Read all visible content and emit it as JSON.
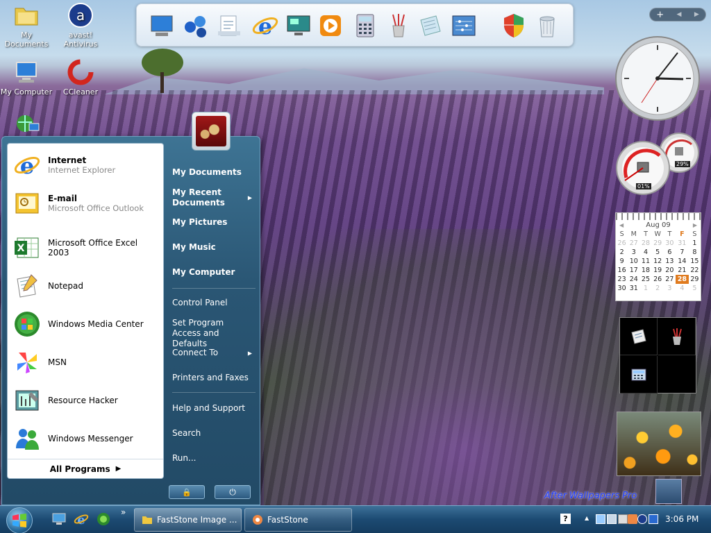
{
  "desktop": {
    "icons": [
      {
        "name": "my-documents",
        "label": "My Documents",
        "icon": "folder-icon"
      },
      {
        "name": "avast",
        "label": "avast! Antivirus",
        "icon": "avast-icon"
      },
      {
        "name": "my-computer",
        "label": "My Computer",
        "icon": "computer-icon"
      },
      {
        "name": "ccleaner",
        "label": "CCleaner",
        "icon": "ccleaner-icon"
      },
      {
        "name": "network",
        "label": "",
        "icon": "network-icon"
      }
    ],
    "watermark": "After Wallpapers Pro"
  },
  "dock": {
    "items": [
      "computer-icon",
      "network-globe-icon",
      "documents-icon",
      "internet-explorer-icon",
      "monitor-icon",
      "media-player-icon",
      "calculator-icon",
      "paint-brushes-icon",
      "notepad-icon",
      "control-panel-icon",
      "security-shield-icon",
      "recycle-bin-icon"
    ]
  },
  "sidebar": {
    "add": "+",
    "prev": "◀",
    "next": "▶"
  },
  "meter": {
    "cpu": "01%",
    "memory": "29%"
  },
  "calendar": {
    "month": "Aug 09",
    "prev": "◀",
    "next": "▶",
    "weekdays": [
      "S",
      "M",
      "T",
      "W",
      "T",
      "F",
      "S"
    ],
    "weeks": [
      [
        "26",
        "27",
        "28",
        "29",
        "30",
        "31",
        "1"
      ],
      [
        "2",
        "3",
        "4",
        "5",
        "6",
        "7",
        "8"
      ],
      [
        "9",
        "10",
        "11",
        "12",
        "13",
        "14",
        "15"
      ],
      [
        "16",
        "17",
        "18",
        "19",
        "20",
        "21",
        "22"
      ],
      [
        "23",
        "24",
        "25",
        "26",
        "27",
        "28",
        "29"
      ],
      [
        "30",
        "31",
        "1",
        "2",
        "3",
        "4",
        "5"
      ]
    ],
    "today": "28"
  },
  "start_menu": {
    "pinned": [
      {
        "title": "Internet",
        "subtitle": "Internet Explorer",
        "icon": "internet-explorer-icon"
      },
      {
        "title": "E-mail",
        "subtitle": "Microsoft Office Outlook",
        "icon": "outlook-icon"
      }
    ],
    "recent": [
      {
        "title": "Microsoft Office Excel 2003",
        "icon": "excel-icon"
      },
      {
        "title": "Notepad",
        "icon": "notepad-icon"
      },
      {
        "title": "Windows Media Center",
        "icon": "media-center-icon"
      },
      {
        "title": "MSN",
        "icon": "msn-icon"
      },
      {
        "title": "Resource Hacker",
        "icon": "resource-hacker-icon"
      },
      {
        "title": "Windows Messenger",
        "icon": "messenger-icon"
      }
    ],
    "all_programs": "All Programs",
    "right": [
      {
        "label": "My Documents",
        "bold": true
      },
      {
        "label": "My Recent Documents",
        "bold": true,
        "submenu": true
      },
      {
        "label": "My Pictures",
        "bold": true
      },
      {
        "label": "My Music",
        "bold": true
      },
      {
        "label": "My Computer",
        "bold": true
      },
      {
        "label": "Control Panel"
      },
      {
        "label": "Set Program Access and Defaults"
      },
      {
        "label": "Connect To",
        "submenu": true
      },
      {
        "label": "Printers and Faxes"
      },
      {
        "label": "Help and Support"
      },
      {
        "label": "Search"
      },
      {
        "label": "Run..."
      }
    ],
    "lock_glyph": "🔒",
    "power_glyph": "⏻"
  },
  "taskbar": {
    "quick_launch": [
      "show-desktop-icon",
      "internet-explorer-icon",
      "media-center-icon"
    ],
    "overflow": "»",
    "buttons": [
      {
        "label": "FastStone Image ...",
        "icon": "folder-icon",
        "active": true
      },
      {
        "label": "FastStone",
        "icon": "faststone-icon",
        "active": false
      }
    ],
    "tray_help": "?",
    "tray_up": "▲",
    "clock": "3:06 PM"
  },
  "colors": {
    "taskbar": "#1c4a72",
    "start_menu": "#2a5674",
    "today": "#e07b1f"
  }
}
